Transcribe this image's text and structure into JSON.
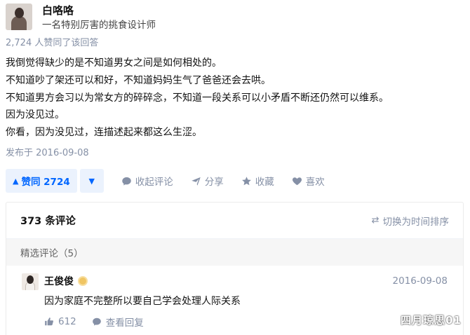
{
  "author": {
    "name": "白咯咯",
    "bio": "一名特别厉害的挑食设计师"
  },
  "upvote_summary": "2,724 人赞同了该回答",
  "answer_lines": [
    "我倒觉得缺少的是不知道男女之间是如何相处的。",
    "不知道吵了架还可以和好，不知道妈妈生气了爸爸还会去哄。",
    "不知道男方会习以为常女方的碎碎念，不知道一段关系可以小矛盾不断还仍然可以维系。",
    "因为没见过。",
    "你看，因为没见过，连描述起来都这么生涩。"
  ],
  "published": "发布于 2016-09-08",
  "actions": {
    "vote_up": "赞同 2724",
    "comment": "收起评论",
    "share": "分享",
    "favorite": "收藏",
    "like": "喜欢"
  },
  "comments": {
    "count_label": "373 条评论",
    "sort_label": "切换为时间排序",
    "featured_label": "精选评论（5）",
    "items": [
      {
        "name": "王俊俊",
        "date": "2016-09-08",
        "text": "因为家庭不完整所以要自己学会处理人际关系",
        "likes": "612",
        "view_replies": "查看回复"
      }
    ]
  },
  "watermark": "四月琼思01",
  "colors": {
    "accent": "#0066ff",
    "accent_bg": "#ebf2fd",
    "meta": "#8590a6"
  }
}
